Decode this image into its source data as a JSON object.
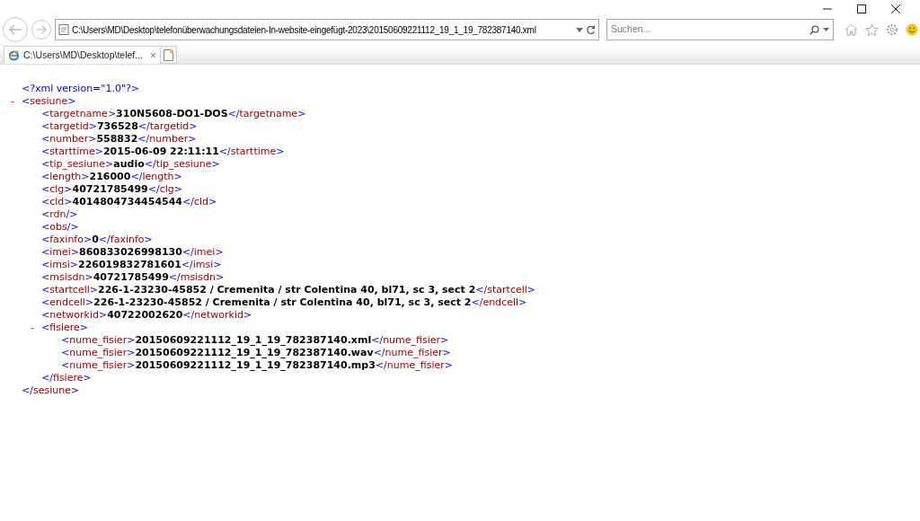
{
  "address_bar": {
    "value": "C:\\Users\\MD\\Desktop\\telefonüberwachungsdateien-In-website-eingefügt-2023\\20150609221112_19_1_19_782387140.xml"
  },
  "search": {
    "placeholder": "Suchen..."
  },
  "tabs": [
    {
      "label": "C:\\Users\\MD\\Desktop\\telef...",
      "selected": true,
      "close": "×"
    }
  ],
  "document": {
    "declaration": "<?xml version=\"1.0\"?>",
    "root": {
      "toggle": "-",
      "expanded": true,
      "open": "<sesiune>",
      "close": "</sesiune>",
      "children": [
        {
          "open": "<targetname>",
          "value": "310N5608-DO1-DOS",
          "close": "</targetname>"
        },
        {
          "open": "<targetid>",
          "value": "736528",
          "close": "</targetid>"
        },
        {
          "open": "<number>",
          "value": "558832",
          "close": "</number>"
        },
        {
          "open": "<starttime>",
          "value": "2015-06-09 22:11:11",
          "close": "</starttime>"
        },
        {
          "open": "<tip_sesiune>",
          "value": "audio",
          "close": "</tip_sesiune>"
        },
        {
          "open": "<length>",
          "value": "216000",
          "close": "</length>"
        },
        {
          "open": "<clg>",
          "value": "40721785499",
          "close": "</clg>"
        },
        {
          "open": "<cld>",
          "value": "4014804734454544",
          "close": "</cld>"
        },
        {
          "open": "<rdn/>"
        },
        {
          "open": "<obs/>"
        },
        {
          "open": "<faxinfo>",
          "value": "0",
          "close": "</faxinfo>"
        },
        {
          "open": "<imei>",
          "value": "860833026998130",
          "close": "</imei>"
        },
        {
          "open": "<imsi>",
          "value": "226019832781601",
          "close": "</imsi>"
        },
        {
          "open": "<msisdn>",
          "value": "40721785499",
          "close": "</msisdn>"
        },
        {
          "open": "<startcell>",
          "value": "226-1-23230-45852 / Cremenita / str Colentina 40, bl71, sc 3, sect 2",
          "close": "</startcell>"
        },
        {
          "open": "<endcell>",
          "value": "226-1-23230-45852 / Cremenita / str Colentina 40, bl71, sc 3, sect 2",
          "close": "</endcell>"
        },
        {
          "open": "<networkid>",
          "value": "40722002620",
          "close": "</networkid>"
        },
        {
          "toggle": "-",
          "expanded": true,
          "open": "<fisiere>",
          "close": "</fisiere>",
          "children": [
            {
              "open": "<nume_fisier>",
              "value": "20150609221112_19_1_19_782387140.xml",
              "close": "</nume_fisier>"
            },
            {
              "open": "<nume_fisier>",
              "value": "20150609221112_19_1_19_782387140.wav",
              "close": "</nume_fisier>"
            },
            {
              "open": "<nume_fisier>",
              "value": "20150609221112_19_1_19_782387140.mp3",
              "close": "</nume_fisier>"
            }
          ]
        }
      ]
    }
  }
}
